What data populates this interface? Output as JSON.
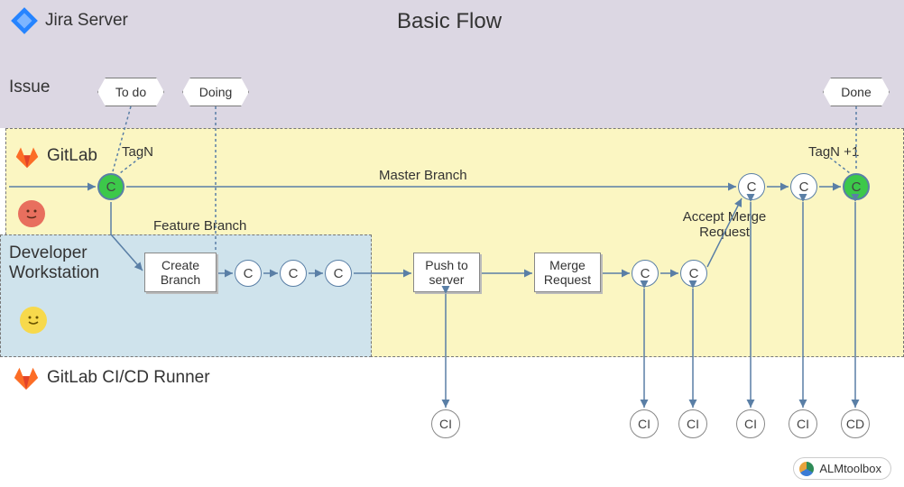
{
  "title": "Basic Flow",
  "lanes": {
    "jira": "Jira Server",
    "issue": "Issue",
    "gitlab": "GitLab",
    "dev": "Developer Workstation",
    "runner": "GitLab CI/CD Runner"
  },
  "hex": {
    "todo": "To do",
    "doing": "Doing",
    "done": "Done"
  },
  "tags": {
    "tagN": "TagN",
    "tagN1": "TagN +1"
  },
  "branches": {
    "master": "Master Branch",
    "feature": "Feature Branch"
  },
  "boxes": {
    "createBranch": "Create Branch",
    "pushToServer": "Push to server",
    "mergeRequest": "Merge Request",
    "acceptMerge": "Accept Merge Request"
  },
  "nodes": {
    "commit": "C",
    "ci": "CI",
    "cd": "CD"
  },
  "brand": "ALMtoolbox"
}
